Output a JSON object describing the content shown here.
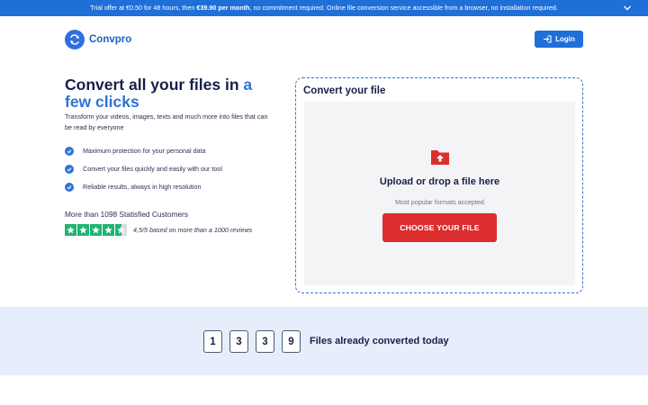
{
  "banner": {
    "text_prefix": "Trial offer at €0.50 for 48 hours, then ",
    "text_bold": "€39.90 per month",
    "text_suffix": ", no commitment required. Online file conversion service accessible from a browser, no installation required.",
    "chevron_icon": "chevron-down-icon"
  },
  "header": {
    "logo_text": "Convpro",
    "logo_icon": "refresh-arrows-icon",
    "login_label": "Login",
    "login_icon": "login-arrow-icon"
  },
  "hero": {
    "title_main": "Convert all your files in ",
    "title_accent_inline": "a",
    "title_accent_line2": "few clicks",
    "subtitle": "Transform your videos, images, texts and much more into files that can be read by everyone",
    "features": [
      "Maximum protection for your personal data",
      "Convert your files quickly and easily with our tool",
      "Reliable results, always in high resolution"
    ],
    "customers_text": "More than 1098 Statisfied Customers",
    "rating_value": 4.5,
    "rating_max": 5,
    "rating_text": "4,5/5 based on more than a 1000 reviews"
  },
  "upload": {
    "title": "Convert your file",
    "drop_title": "Upload or drop a file here",
    "formats_text": "Most popular formats accepted",
    "choose_label": "CHOOSE YOUR FILE",
    "folder_icon": "folder-upload-icon"
  },
  "counter": {
    "digits": [
      "1",
      "3",
      "3",
      "9"
    ],
    "label": "Files already converted today"
  },
  "colors": {
    "primary": "#1f6fd8",
    "accent_text": "#2e74d6",
    "cta_red": "#dc2d2f",
    "rating_green": "#1fb473",
    "counter_bg": "#e6eefb"
  }
}
